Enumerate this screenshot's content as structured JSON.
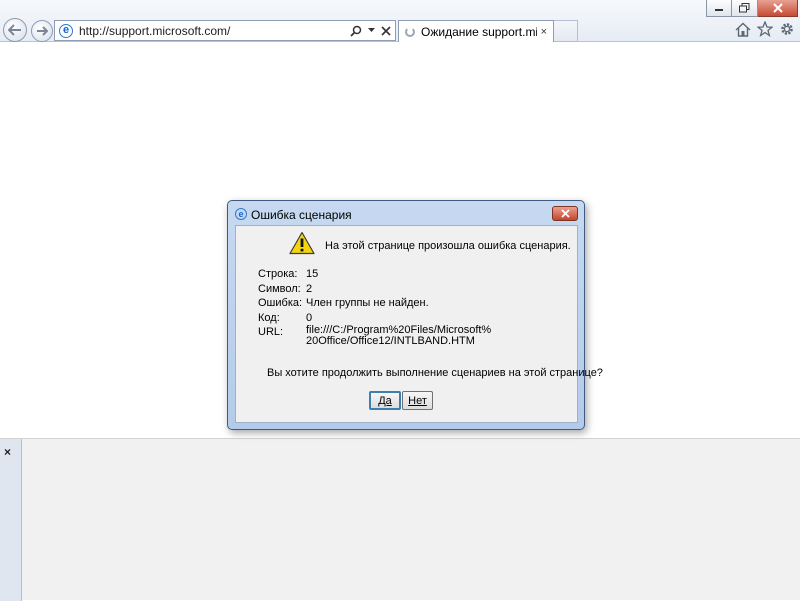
{
  "browser": {
    "address": {
      "url": "http://support.microsoft.com/"
    },
    "tab": {
      "title": "Ожидание support.micros...",
      "close_glyph": "×"
    },
    "caption": {
      "minimize": "—",
      "restore": "❐",
      "close": "✕"
    },
    "icons": [
      "back-arrow-icon",
      "forward-arrow-icon",
      "ie-logo-icon",
      "search-icon",
      "dropdown-icon",
      "stop-icon",
      "home-icon",
      "favorites-star-icon",
      "gear-icon"
    ]
  },
  "dialog": {
    "title": "Ошибка сценария",
    "message": "На этой странице произошла ошибка сценария.",
    "details": [
      {
        "label": "Строка:",
        "value": "15"
      },
      {
        "label": "Символ:",
        "value": "2"
      },
      {
        "label": "Ошибка:",
        "value": "Член группы не найден."
      },
      {
        "label": "Код:",
        "value": "0"
      }
    ],
    "url_label": "URL:",
    "url_value_line1": "file:///C:/Program%20Files/Microsoft%",
    "url_value_line2": "20Office/Office12/INTLBAND.HTM",
    "question": "Вы хотите продолжить выполнение сценариев на этой странице?",
    "yes_label": "Да",
    "no_label": "Нет"
  },
  "bottom_pane": {
    "close_glyph": "×"
  },
  "colors": {
    "dialog_frame": "#b9d1ee",
    "dialog_body": "#f0f0f0",
    "close_button": "#c74a34",
    "warning_yellow": "#f5d40c"
  }
}
